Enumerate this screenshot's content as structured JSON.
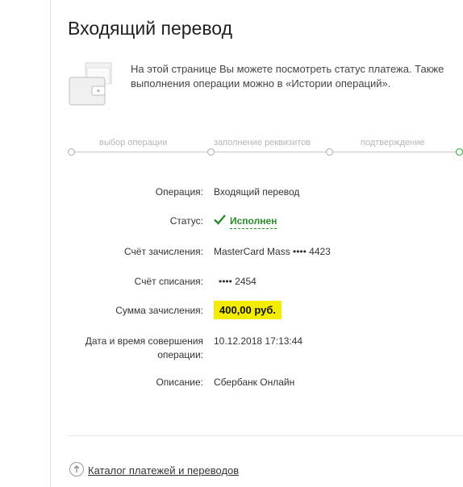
{
  "page": {
    "title": "Входящий перевод",
    "info_line1": "На этой странице Вы можете посмотреть статус платежа. Также",
    "info_line2": "выполнения операции можно в «Истории операций»."
  },
  "steps": [
    "выбор операции",
    "заполнение реквизитов",
    "подтверждение"
  ],
  "details": {
    "operation_label": "Операция:",
    "operation_value": "Входящий перевод",
    "status_label": "Статус:",
    "status_value": "Исполнен",
    "credit_account_label": "Счёт зачисления:",
    "credit_account_value": "MasterCard Mass  •••• 4423",
    "debit_account_label": "Счёт списания:",
    "debit_account_value": "•••• 2454",
    "amount_label": "Сумма зачисления:",
    "amount_value": "400,00 руб.",
    "datetime_label_line1": "Дата и время совершения",
    "datetime_label_line2": "операции:",
    "datetime_value": "10.12.2018 17:13:44",
    "description_label": "Описание:",
    "description_value": "Сбербанк Онлайн"
  },
  "footer": {
    "catalog_link": "Каталог платежей и переводов"
  },
  "colors": {
    "status_green": "#2b8a2b",
    "amount_highlight": "#f4ec00",
    "step_active": "#2aa82a"
  },
  "icons": [
    "wallet-icon",
    "check-icon",
    "back-arrow-icon"
  ]
}
